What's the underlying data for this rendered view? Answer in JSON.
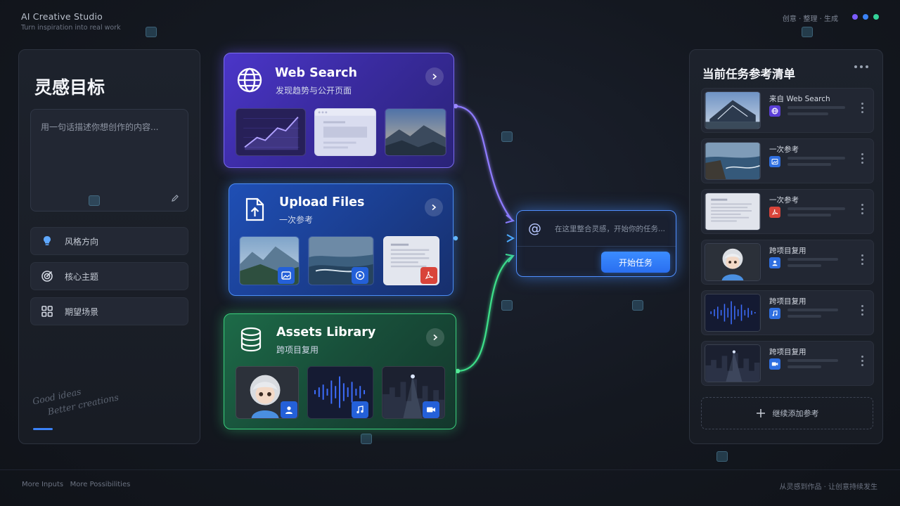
{
  "header": {
    "brand_title": "AI Creative Studio",
    "brand_subtitle": "Turn inspiration into real work",
    "nav": "创意 · 整理 · 生成",
    "dot_colors": [
      "#7c5cff",
      "#3b82f6",
      "#34d399"
    ]
  },
  "left_panel": {
    "title": "灵感目标",
    "prompt_placeholder": "用一句话描述你想创作的内容...",
    "options": [
      {
        "label": "风格方向",
        "icon": "lightbulb-icon"
      },
      {
        "label": "核心主题",
        "icon": "target-icon"
      },
      {
        "label": "期望场景",
        "icon": "grid-icon"
      }
    ],
    "slogan_line1": "Good ideas",
    "slogan_line2": "Better creations"
  },
  "sources": {
    "web": {
      "title": "Web Search",
      "subtitle": "发现趋势与公开页面",
      "icon": "globe-icon",
      "accent": "#7b6cf0"
    },
    "upload": {
      "title": "Upload Files",
      "subtitle": "一次参考",
      "icon": "upload-file-icon",
      "accent": "#4b8df5"
    },
    "assets": {
      "title": "Assets Library",
      "subtitle": "跨项目复用",
      "icon": "database-icon",
      "accent": "#3ad07c"
    }
  },
  "task": {
    "at_symbol": "@",
    "placeholder": "在这里整合灵感，开始你的任务...",
    "start_label": "开始任务"
  },
  "right_panel": {
    "title": "当前任务参考清单",
    "items": [
      {
        "label": "来自 Web Search",
        "icon": "globe-icon",
        "badge_color": "#5b3fd8"
      },
      {
        "label": "一次参考",
        "icon": "image-icon",
        "badge_color": "#2f6fe0"
      },
      {
        "label": "一次参考",
        "icon": "pdf-icon",
        "badge_color": "#d9443a"
      },
      {
        "label": "跨项目复用",
        "icon": "person-icon",
        "badge_color": "#2f6fe0"
      },
      {
        "label": "跨项目复用",
        "icon": "music-icon",
        "badge_color": "#2f6fe0"
      },
      {
        "label": "跨项目复用",
        "icon": "video-icon",
        "badge_color": "#2f6fe0"
      }
    ],
    "add_label": "继续添加参考"
  },
  "footer": {
    "left": "More Inputs   More Possibilities",
    "right": "从灵感到作品 · 让创意持续发生"
  }
}
